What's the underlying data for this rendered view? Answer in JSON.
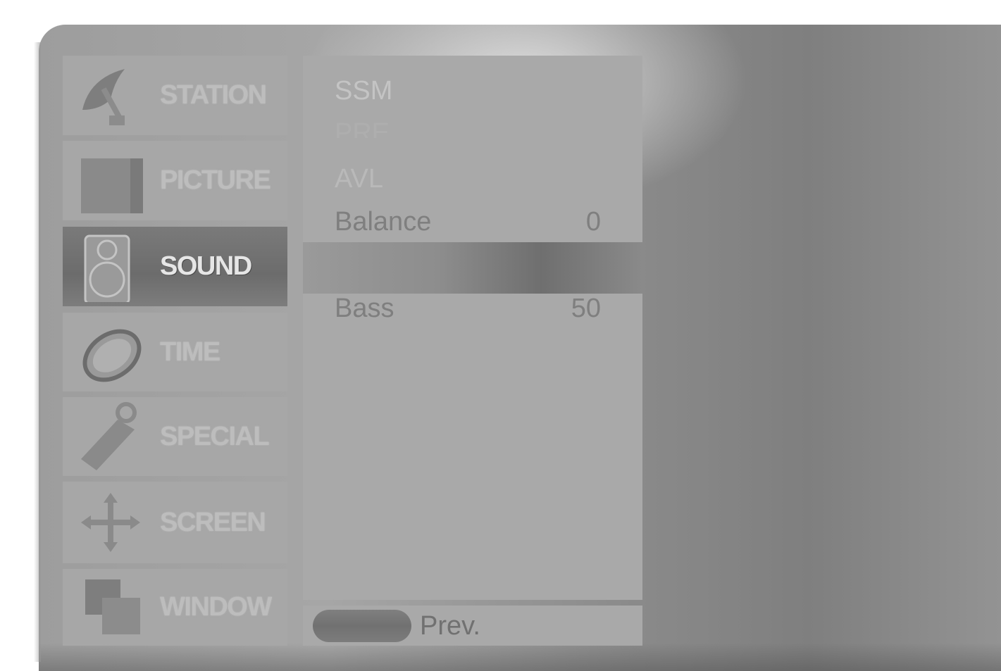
{
  "menu": {
    "items": [
      {
        "label": "STATION",
        "icon": "satellite-dish-icon"
      },
      {
        "label": "PICTURE",
        "icon": "tv-screen-icon"
      },
      {
        "label": "SOUND",
        "icon": "speaker-icon"
      },
      {
        "label": "TIME",
        "icon": "clock-icon"
      },
      {
        "label": "SPECIAL",
        "icon": "key-tag-icon"
      },
      {
        "label": "SCREEN",
        "icon": "move-arrows-icon"
      },
      {
        "label": "WINDOW",
        "icon": "window-icon"
      }
    ],
    "active": "SOUND"
  },
  "sound_panel": {
    "ssm": "SSM",
    "pre": "PRE",
    "avl": "AVL",
    "balance_label": "Balance",
    "balance_value": "0",
    "bass_label": "Bass",
    "bass_value": "50"
  },
  "footer": {
    "prev_label": "Prev."
  },
  "colors": {
    "osd_panel": "#a9a9a9",
    "active_item": "#717171",
    "prev_button": "#777777"
  }
}
